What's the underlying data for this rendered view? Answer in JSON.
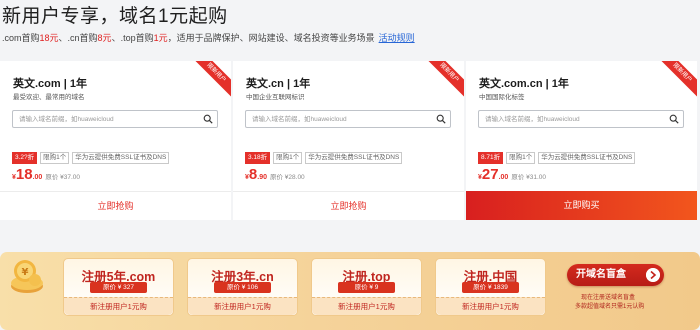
{
  "header": {
    "title": "新用户专享，域名1元起购",
    "sub_parts": [
      ".com首购",
      "18元",
      "、.cn首购",
      "8元",
      "、.top首购",
      "1元",
      "，适用于品牌保护、网站建设、域名投资等业务场景"
    ],
    "rules_link": "活动规则"
  },
  "search_placeholder": "请输入域名前缀，如huaweicloud",
  "cards": [
    {
      "name": "英文.com | 1年",
      "desc": "最受欢迎、最常用的域名",
      "ribbon": "限新用户",
      "discount": "3.2?折",
      "tags": [
        "限购1个",
        "华为云提供免费SSL证书及DNS"
      ],
      "price_symbol": "¥",
      "price_int": "18",
      "price_dec": ".00",
      "original": "原价 ¥37.00",
      "button": "立即抢购",
      "primary": false
    },
    {
      "name": "英文.cn | 1年",
      "desc": "中国企业互联网标识",
      "ribbon": "限新用户",
      "discount": "3.18折",
      "tags": [
        "限购1个",
        "华为云提供免费SSL证书及DNS"
      ],
      "price_symbol": "¥",
      "price_int": "8",
      "price_dec": ".90",
      "original": "原价 ¥28.00",
      "button": "立即抢购",
      "primary": false
    },
    {
      "name": "英文.com.cn | 1年",
      "desc": "中国国际化标签",
      "ribbon": "限新用户",
      "discount": "8.71折",
      "tags": [
        "限购1个",
        "华为云提供免费SSL证书及DNS"
      ],
      "price_symbol": "¥",
      "price_int": "27",
      "price_dec": ".00",
      "original": "原价 ¥31.00",
      "button": "立即购买",
      "primary": true
    }
  ],
  "banner": {
    "offers": [
      {
        "title": "注册5年.com",
        "price": "原价 ¥ 327",
        "foot": "新注册用户1元购"
      },
      {
        "title": "注册3年.cn",
        "price": "原价 ¥ 106",
        "foot": "新注册用户1元购"
      },
      {
        "title": "注册.top",
        "price": "原价 ¥ 9",
        "foot": "新注册用户1元购"
      },
      {
        "title": "注册.中国",
        "price": "原价 ¥ 1839",
        "foot": "新注册用户1元购"
      }
    ],
    "blind_box_button": "开域名盲盒",
    "note_lines": [
      "现在注册送域名盲盒",
      "多款超值域名只需1元认购"
    ]
  },
  "colors": {
    "accent": "#e4302a",
    "link": "#2766d6",
    "banner_bg": "#f5d39a"
  }
}
